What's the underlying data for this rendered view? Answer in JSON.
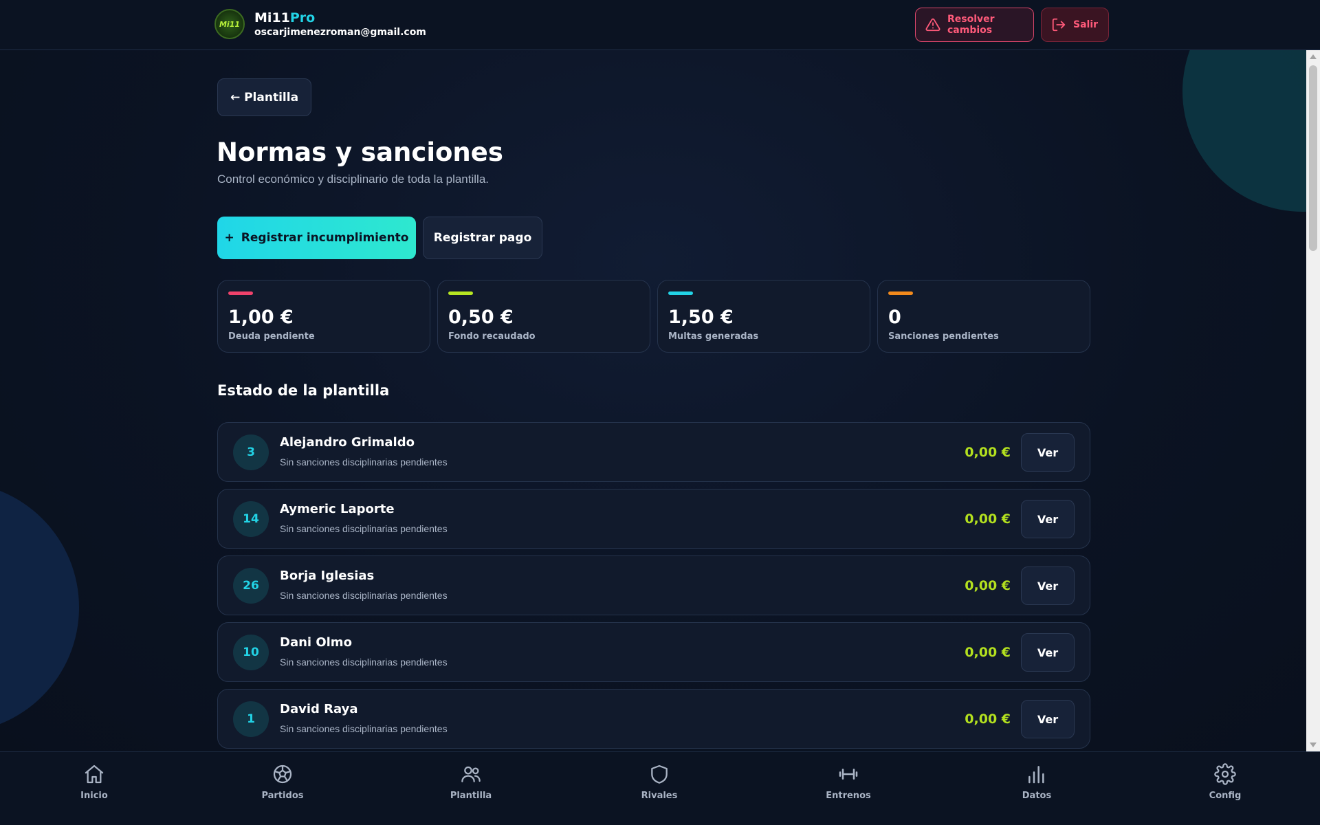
{
  "header": {
    "logo_text": "Mi11",
    "brand_main": "Mi11",
    "brand_accent": "Pro",
    "email": "oscarjimenezroman@gmail.com",
    "resolve_label": "Resolver cambios",
    "exit_label": "Salir"
  },
  "page": {
    "back_label": "← Plantilla",
    "title": "Normas y sanciones",
    "subtitle": "Control económico y disciplinario de toda la plantilla.",
    "primary_plus": "+",
    "primary_label": "Registrar incumplimiento",
    "secondary_label": "Registrar pago"
  },
  "stats": [
    {
      "value": "1,00 €",
      "label": "Deuda pendiente",
      "color": "#f0426b"
    },
    {
      "value": "0,50 €",
      "label": "Fondo recaudado",
      "color": "#b6e622"
    },
    {
      "value": "1,50 €",
      "label": "Multas generadas",
      "color": "#22d3e6"
    },
    {
      "value": "0",
      "label": "Sanciones pendientes",
      "color": "#f28a1c"
    }
  ],
  "section_title": "Estado de la plantilla",
  "players": [
    {
      "number": "3",
      "name": "Alejandro Grimaldo",
      "status": "Sin sanciones disciplinarias pendientes",
      "amount": "0,00 €",
      "action": "Ver"
    },
    {
      "number": "14",
      "name": "Aymeric Laporte",
      "status": "Sin sanciones disciplinarias pendientes",
      "amount": "0,00 €",
      "action": "Ver"
    },
    {
      "number": "26",
      "name": "Borja Iglesias",
      "status": "Sin sanciones disciplinarias pendientes",
      "amount": "0,00 €",
      "action": "Ver"
    },
    {
      "number": "10",
      "name": "Dani Olmo",
      "status": "Sin sanciones disciplinarias pendientes",
      "amount": "0,00 €",
      "action": "Ver"
    },
    {
      "number": "1",
      "name": "David Raya",
      "status": "Sin sanciones disciplinarias pendientes",
      "amount": "0,00 €",
      "action": "Ver"
    }
  ],
  "nav": [
    {
      "label": "Inicio",
      "icon": "home-icon"
    },
    {
      "label": "Partidos",
      "icon": "soccer-ball-icon"
    },
    {
      "label": "Plantilla",
      "icon": "users-icon"
    },
    {
      "label": "Rivales",
      "icon": "shield-icon"
    },
    {
      "label": "Entrenos",
      "icon": "dumbbell-icon"
    },
    {
      "label": "Datos",
      "icon": "bar-chart-icon"
    },
    {
      "label": "Config",
      "icon": "gear-icon"
    }
  ]
}
